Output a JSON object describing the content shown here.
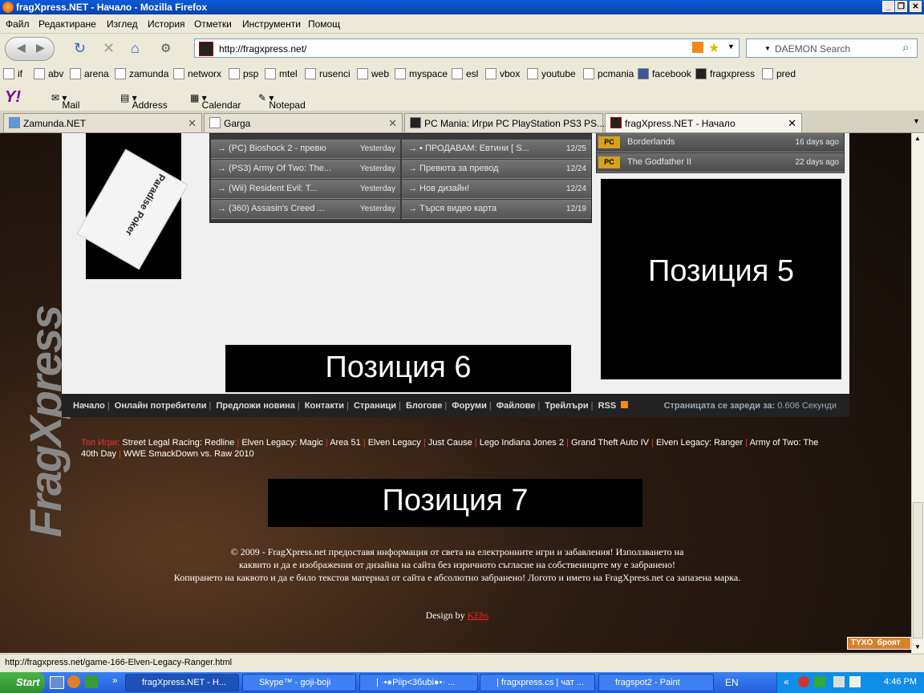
{
  "window": {
    "title": "fragXpress.NET - Начало - Mozilla Firefox"
  },
  "menu": [
    "Файл",
    "Редактиране",
    "Изглед",
    "История",
    "Отметки",
    "Инструменти",
    "Помощ"
  ],
  "nav": {
    "url": "http://fragxpress.net/",
    "search_placeholder": "DAEMON Search"
  },
  "bookmarks": [
    "if",
    "abv",
    "arena",
    "zamunda",
    "networx",
    "psp",
    "mtel",
    "rusenci",
    "web",
    "myspace",
    "esl",
    "vbox",
    "youtube",
    "pcmania",
    "facebook",
    "fragxpress",
    "pred"
  ],
  "yahoo_bar": {
    "mail": "Mail",
    "address_book": "Address Book",
    "calendar": "Calendar",
    "notepad": "Notepad"
  },
  "tabs": [
    {
      "label": "Zamunda.NET"
    },
    {
      "label": "Garga"
    },
    {
      "label": "PC Mania: Игри PC PlayStation PS3 PS..."
    },
    {
      "label": "fragXpress.NET - Начало"
    }
  ],
  "news_left": [
    {
      "title": "→ (PC) Bioshock 2 - превю",
      "date": "Yesterday"
    },
    {
      "title": "→ (PS3) Army Of Two: The...",
      "date": "Yesterday"
    },
    {
      "title": "→ (Wii) Resident Evil: T...",
      "date": "Yesterday"
    },
    {
      "title": "→ (360) Assasin's Creed ...",
      "date": "Yesterday"
    }
  ],
  "news_right": [
    {
      "title": "→ ▪ ПРОДАВАМ: Евтини [ S...",
      "date": "12/25"
    },
    {
      "title": "→ Превюта за превод",
      "date": "12/24"
    },
    {
      "title": "→ Нов дизайн!",
      "date": "12/24"
    },
    {
      "title": "→ Търся видео карта",
      "date": "12/19"
    }
  ],
  "games": [
    {
      "platform": "PC",
      "name": "Borderlands",
      "ago": "16 days ago"
    },
    {
      "platform": "PC",
      "name": "The Godfather II",
      "ago": "22 days ago"
    }
  ],
  "poker_card": "Paradise Poker",
  "side_logo": "FragXpress",
  "positions": {
    "p5": "Позиция  5",
    "p6": "Позиция 6",
    "p7": "Позиция 7"
  },
  "footer_menu": [
    "Начало",
    "Онлайн потребители",
    "Предложи новина",
    "Контакти",
    "Страници",
    "Блогове",
    "Форуми",
    "Файлове",
    "Трейлъри",
    "RSS"
  ],
  "load_time": {
    "label": "Страницата се зареди за:",
    "value": "0.606 Секунди"
  },
  "top_games": {
    "label": "Топ Игри:",
    "items": [
      "Street Legal Racing: Redline",
      "Elven Legacy: Magic",
      "Area 51",
      "Elven Legacy",
      "Just Cause",
      "Lego Indiana Jones 2",
      "Grand Theft Auto IV",
      "Elven Legacy: Ranger",
      "Army of Two: The 40th Day",
      "WWE SmackDown vs. Raw 2010"
    ]
  },
  "copyright": {
    "line1": "© 2009 - FragXpress.net предоставя информация от света на електронните игри и забавления! Използването на",
    "line2": "каквито и да е изображения от дизайна на сайта без изричното съгласие на собствениците му е забранено!",
    "line3": "Копирането на каквото и да е било текстов материал от сайта е абсолютно забранено! Логото и името на FragXpress.net са запазена марка."
  },
  "design": {
    "label": "Design by",
    "author": "KEhs"
  },
  "counter_badge": "TYXO  броят",
  "status_text": "http://fragxpress.net/game-166-Elven-Legacy-Ranger.html",
  "taskbar": {
    "start": "Start",
    "tasks": [
      "fragXpress.NET - H...",
      "Skype™ - goji-boji",
      "| ·•●Piip<3бubi●•· ...",
      "| fragxpress.cs | чат ...",
      "fragspot2 - Paint"
    ],
    "lang": "EN",
    "clock": "4:46 PM"
  },
  "colors": {
    "accent_red": "#e33333",
    "pc_badge": "#d6a020",
    "title_blue": "#0a5bd8"
  }
}
